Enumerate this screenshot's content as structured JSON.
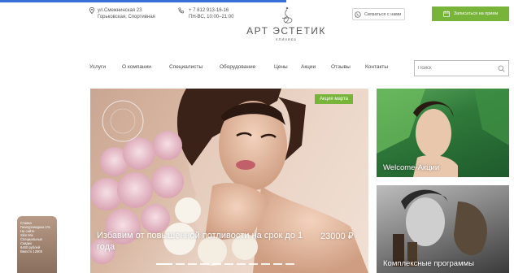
{
  "header": {
    "address_line1": "ул.Смежнинская 23",
    "address_line2": "Горьковская, Спортивная",
    "phone": "+ 7 812 913-16-16",
    "hours": "ПН-ВС, 10:00–21:00",
    "logo_name": "АРТ ЭСТЕТИК",
    "logo_sub": "клиника",
    "whatsapp_label": "Связаться с нами",
    "appointment_label": "Записаться на прием"
  },
  "nav": {
    "items": [
      {
        "label": "Услуги"
      },
      {
        "label": "О компании"
      },
      {
        "label": "Специалисты"
      },
      {
        "label": "Оборудование"
      },
      {
        "label": "Цены"
      },
      {
        "label": "Акции"
      },
      {
        "label": "Отзывы"
      },
      {
        "label": "Контакты"
      }
    ]
  },
  "search": {
    "placeholder": "Поиск"
  },
  "hero": {
    "badge": "Акция марта",
    "title": "Избавим от повышенной потливости на срок до 1 года",
    "price": "23000 ₽",
    "slide_count": 11,
    "active_slide": 0
  },
  "cards": [
    {
      "label": "Welcome-Акции"
    },
    {
      "label": "Комплексные программы"
    }
  ],
  "widget": {
    "lines": [
      "Ставка",
      "Гиалуронидаза 1%",
      "На сайте",
      "Skin Mix",
      "Специальные",
      "Скидки",
      "6400 рублей",
      "Вместо 12800"
    ]
  },
  "colors": {
    "accent": "#78b43a",
    "topbar": "#3a6fd8"
  }
}
